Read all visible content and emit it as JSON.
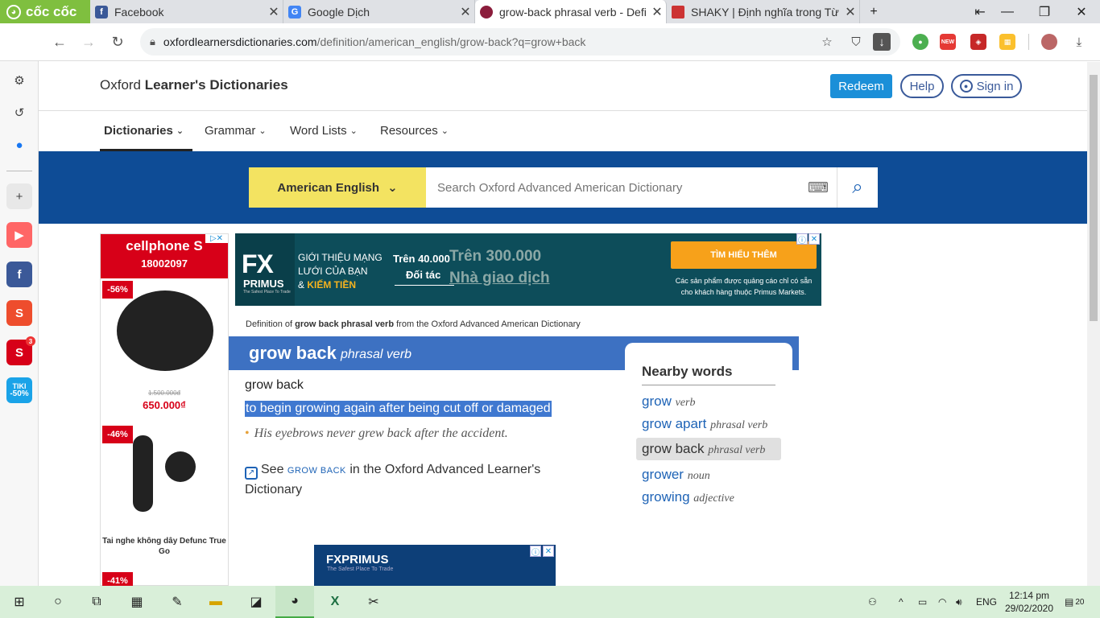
{
  "browser": {
    "brand": "cốc cốc",
    "tabs": [
      {
        "title": "Facebook",
        "active": false
      },
      {
        "title": "Google Dịch",
        "active": false
      },
      {
        "title": "grow-back phrasal verb - Defi",
        "active": true
      },
      {
        "title": "SHAKY | Định nghĩa trong Từ",
        "active": false
      }
    ],
    "new_tab": "+",
    "url_host": "oxfordlearnersdictionaries.com",
    "url_path": "/definition/american_english/grow-back?q=grow+back",
    "ext_new_badge": "NEW"
  },
  "sidebar": {
    "shopee_badge": "3",
    "tiki_label": "TIKI",
    "tiki_discount": "-50%"
  },
  "site": {
    "title_plain": "Oxford ",
    "title_bold": "Learner's Dictionaries",
    "redeem": "Redeem",
    "help": "Help",
    "signin": "Sign in",
    "menu": [
      "Dictionaries",
      "Grammar",
      "Word Lists",
      "Resources"
    ],
    "dict_selector": "American English",
    "search_placeholder": "Search Oxford Advanced American Dictionary"
  },
  "ads": {
    "left": {
      "brand": "cellphone S",
      "phone": "18002097",
      "items": [
        {
          "discount": "-56%",
          "old_price": "1.500.000đ",
          "price": "650.000₫"
        },
        {
          "discount": "-46%",
          "name": "Tai nghe không dây Defunc True Go"
        },
        {
          "discount": "-41%"
        }
      ]
    },
    "top": {
      "logo": "FX",
      "logo_sub": "PRIMUS",
      "logo_tiny": "The Safest Place To Trade",
      "tag_line1": "GIỚI THIỆU MẠNG",
      "tag_line2": "LƯỚI CỦA BẠN",
      "tag_prefix": "& ",
      "tag_highlight": "KIẾM TIỀN",
      "stat_small_1": "Trên 40.000",
      "stat_small_2": "Đối tác",
      "stat_big_1": "Trên 300.000",
      "stat_big_2": "Nhà giao dịch",
      "cta": "TÌM HIỂU THÊM",
      "note": "Các sản phẩm được quảng cáo chỉ có sẵn cho khách hàng thuộc Primus Markets."
    },
    "bottom": {
      "logo": "FXPRIMUS",
      "tiny": "The Safest Place To Trade"
    }
  },
  "entry": {
    "source_prefix": "Definition of ",
    "source_bold": "grow back phrasal verb",
    "source_suffix": " from the Oxford Advanced American Dictionary",
    "headword": "grow back",
    "pos": "phrasal verb",
    "sense_head": "grow back",
    "definition": "to begin growing again after being cut off or damaged",
    "example": "His eyebrows never grew back after the accident.",
    "see_prefix": "See ",
    "see_link": "GROW BACK",
    "see_suffix": " in the Oxford Advanced Learner's Dictionary"
  },
  "nearby": {
    "title": "Nearby words",
    "items": [
      {
        "word": "grow",
        "pos": "verb"
      },
      {
        "word": "grow apart",
        "pos": "phrasal verb"
      },
      {
        "word": "grow back",
        "pos": "phrasal verb",
        "current": true
      },
      {
        "word": "grower",
        "pos": "noun"
      },
      {
        "word": "growing",
        "pos": "adjective"
      }
    ]
  },
  "taskbar": {
    "lang": "ENG",
    "time": "12:14 pm",
    "date": "29/02/2020",
    "notif_count": "20"
  }
}
